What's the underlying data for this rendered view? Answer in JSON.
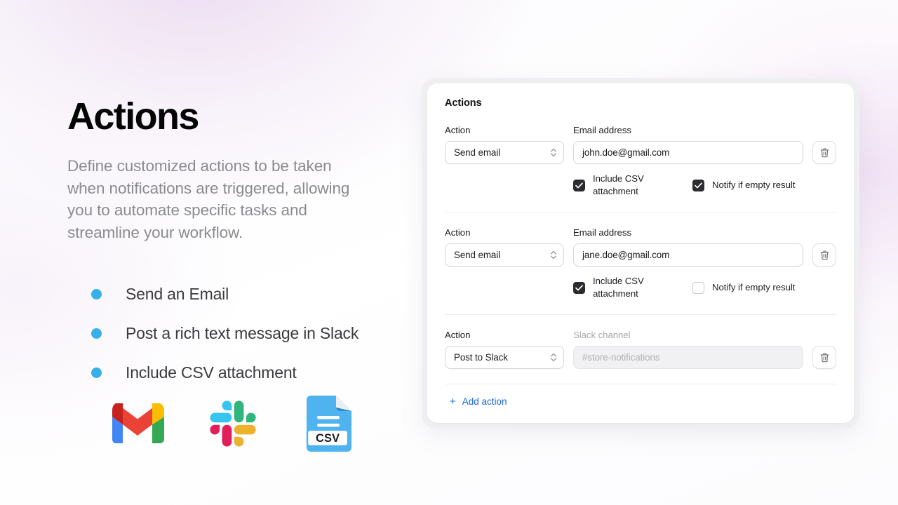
{
  "hero": {
    "title": "Actions",
    "subtitle": "Define customized actions to be taken when notifications are triggered, allowing you to automate specific tasks and streamline your workflow.",
    "bullet_color": "#37b0e9",
    "features": [
      {
        "label": "Send an Email"
      },
      {
        "label": "Post a rich text message in Slack"
      },
      {
        "label": "Include CSV attachment"
      }
    ],
    "logos": [
      {
        "name": "gmail-logo",
        "title": "Gmail"
      },
      {
        "name": "slack-logo",
        "title": "Slack"
      },
      {
        "name": "csv-file-logo",
        "title": "CSV",
        "badge_text": "CSV"
      }
    ]
  },
  "card": {
    "title": "Actions",
    "accent_color": "#1866e0",
    "add_action": {
      "plus": "+",
      "label": "Add action"
    },
    "rows": [
      {
        "action_label": "Action",
        "action_value": "Send email",
        "value_label": "Email address",
        "value_label_muted": false,
        "value_text": "john.doe@gmail.com",
        "value_disabled": false,
        "delete_icon": "trash-icon",
        "checkboxes": [
          {
            "label": "Include CSV attachment",
            "checked": true
          },
          {
            "label": "Notify if empty result",
            "checked": true
          }
        ]
      },
      {
        "action_label": "Action",
        "action_value": "Send email",
        "value_label": "Email address",
        "value_label_muted": false,
        "value_text": "jane.doe@gmail.com",
        "value_disabled": false,
        "delete_icon": "trash-icon",
        "checkboxes": [
          {
            "label": "Include CSV attachment",
            "checked": true
          },
          {
            "label": "Notify if empty result",
            "checked": false
          }
        ]
      },
      {
        "action_label": "Action",
        "action_value": "Post to Slack",
        "value_label": "Slack channel",
        "value_label_muted": true,
        "value_text": "#store-notifications",
        "value_disabled": true,
        "delete_icon": "trash-icon",
        "checkboxes": []
      }
    ]
  }
}
